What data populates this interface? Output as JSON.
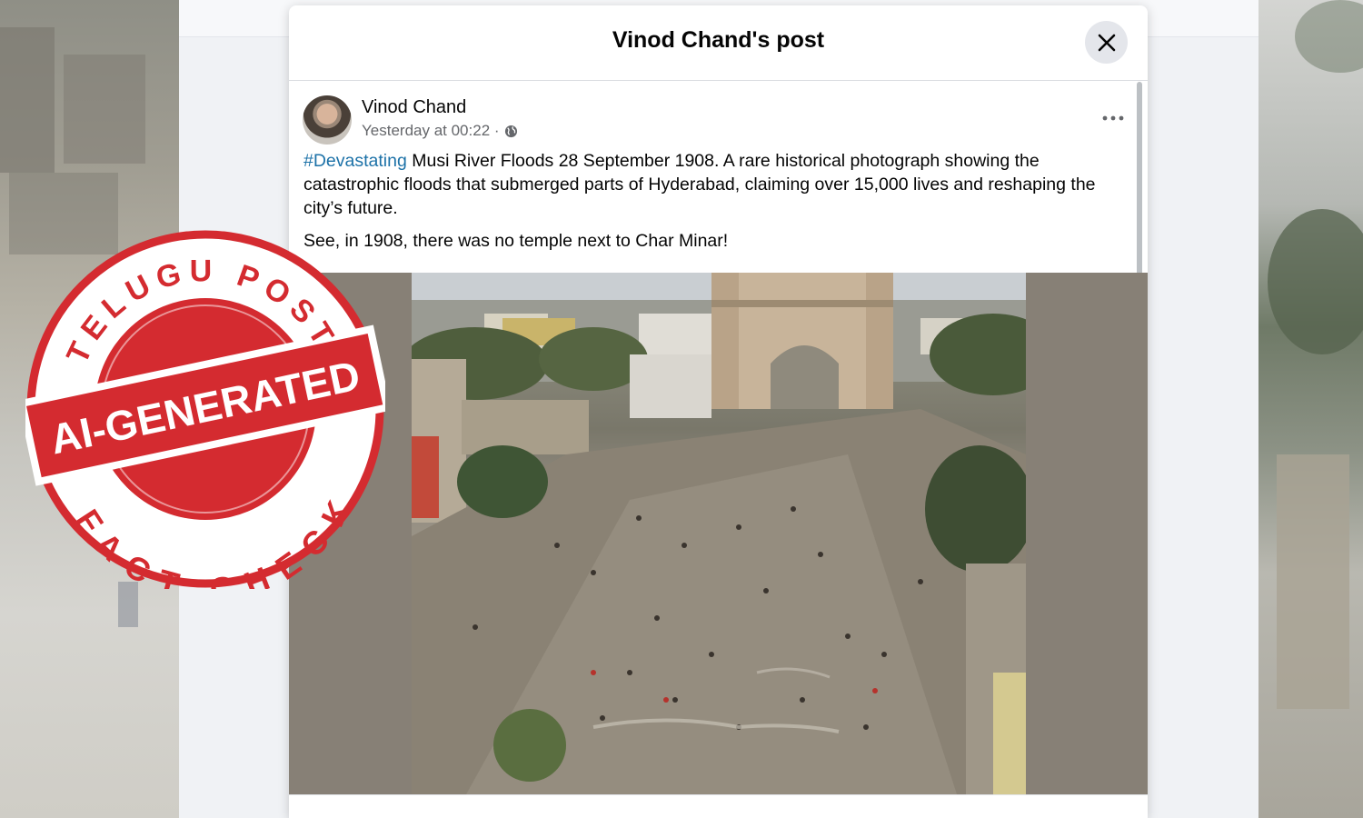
{
  "modal": {
    "title": "Vinod Chand's post",
    "close_icon": "close-icon"
  },
  "post": {
    "author": "Vinod Chand",
    "timestamp": "Yesterday at 00:22 ·",
    "privacy_icon": "globe-icon",
    "more_icon": "more-options-icon",
    "hashtag": "#Devastating",
    "body_line1": " Musi River Floods 28 September 1908. A rare historical photograph showing the catastrophic floods that submerged parts of Hyderabad, claiming over 15,000 lives and reshaping the city’s future.",
    "body_line2": "See, in 1908, there was no temple next to Char Minar!"
  },
  "stamp": {
    "top_text": "TELUGU POST",
    "band_text": "AI-GENERATED",
    "bottom_text": "FACT CHECK",
    "color": "#d42b30"
  },
  "colors": {
    "hashtag": "#1d72a8",
    "text": "#050505",
    "meta": "#65676b"
  }
}
